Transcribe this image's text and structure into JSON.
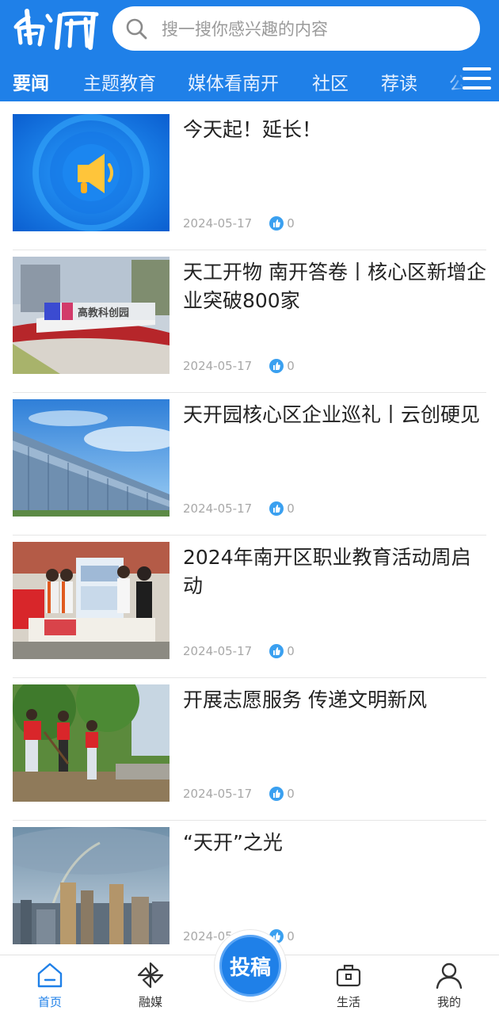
{
  "header": {
    "logo_text": "南开",
    "search_placeholder": "搜一搜你感兴趣的内容",
    "tabs": [
      {
        "label": "要闻"
      },
      {
        "label": "主题教育"
      },
      {
        "label": "媒体看南开"
      },
      {
        "label": "社区"
      },
      {
        "label": "荐读"
      },
      {
        "label": "公"
      }
    ],
    "accent": "#1f80e8"
  },
  "articles": [
    {
      "title": "今天起！延长！",
      "date": "2024-05-17",
      "likes": "0",
      "thumb": "megaphone"
    },
    {
      "title": "天工开物 南开答卷丨核心区新增企业突破800家",
      "date": "2024-05-17",
      "likes": "0",
      "thumb": "tech-park-sign"
    },
    {
      "title": "天开园核心区企业巡礼丨云创硬见",
      "date": "2024-05-17",
      "likes": "0",
      "thumb": "glass-building"
    },
    {
      "title": "2024年南开区职业教育活动周启动",
      "date": "2024-05-17",
      "likes": "0",
      "thumb": "exhibition-booth"
    },
    {
      "title": "开展志愿服务 传递文明新风",
      "date": "2024-05-17",
      "likes": "0",
      "thumb": "volunteers"
    },
    {
      "title": "“天开”之光",
      "date": "2024-05-17",
      "likes": "0",
      "thumb": "city-skyline"
    }
  ],
  "bottom_nav": [
    {
      "label": "首页",
      "icon": "home-icon"
    },
    {
      "label": "融媒",
      "icon": "pinwheel-icon"
    },
    {
      "label": "投稿",
      "icon": "submit-button"
    },
    {
      "label": "生活",
      "icon": "briefcase-icon"
    },
    {
      "label": "我的",
      "icon": "user-icon"
    }
  ]
}
